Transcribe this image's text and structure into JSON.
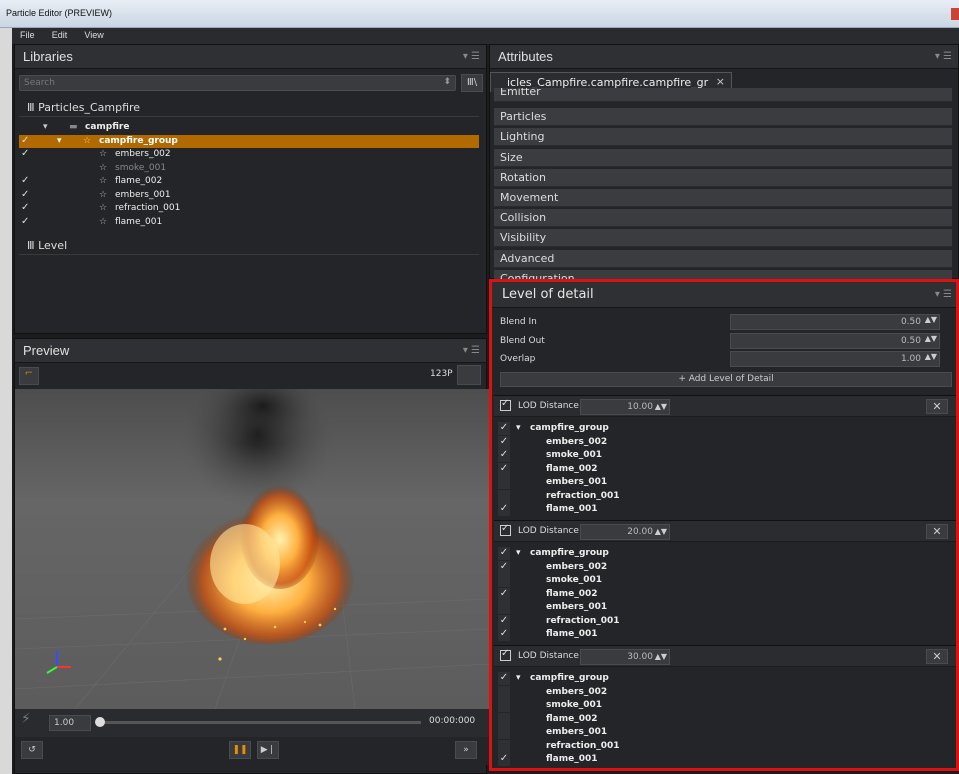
{
  "window": {
    "title": "Particle Editor (PREVIEW)"
  },
  "menu": [
    "File",
    "Edit",
    "View"
  ],
  "libraries": {
    "title": "Libraries",
    "search_placeholder": "Search",
    "library_name": "Particles_Campfire",
    "root_folder": "campfire",
    "group": "campfire_group",
    "items": [
      {
        "name": "embers_002",
        "checked": true
      },
      {
        "name": "smoke_001",
        "checked": false
      },
      {
        "name": "flame_002",
        "checked": true
      },
      {
        "name": "embers_001",
        "checked": true
      },
      {
        "name": "refraction_001",
        "checked": true
      },
      {
        "name": "flame_001",
        "checked": true
      }
    ],
    "level_name": "Level"
  },
  "preview": {
    "title": "Preview",
    "fps_label": "123P",
    "speed": "1.00",
    "time": "00:00:000"
  },
  "attributes": {
    "title": "Attributes",
    "tab_label": "icles_Campfire.campfire.campfire_gr",
    "tab_close": "×",
    "categories": [
      "Emitter",
      "Particles",
      "Lighting",
      "Size",
      "Rotation",
      "Movement",
      "Collision",
      "Visibility",
      "Advanced",
      "Configuration"
    ]
  },
  "lod": {
    "title": "Level of detail",
    "props": [
      {
        "label": "Blend In",
        "value": "0.50"
      },
      {
        "label": "Blend Out",
        "value": "0.50"
      },
      {
        "label": "Overlap",
        "value": "1.00"
      }
    ],
    "add_label": "+ Add Level of Detail",
    "distance_label": "LOD Distance",
    "remove_label": "✕",
    "group": "campfire_group",
    "levels": [
      {
        "distance": "10.00",
        "checks": [
          true,
          true,
          true,
          false,
          false,
          true
        ],
        "group_checked": true
      },
      {
        "distance": "20.00",
        "checks": [
          true,
          false,
          true,
          false,
          true,
          true
        ],
        "group_checked": true
      },
      {
        "distance": "30.00",
        "checks": [
          false,
          false,
          false,
          false,
          false,
          true
        ],
        "group_checked": true
      }
    ],
    "item_names": [
      "embers_002",
      "smoke_001",
      "flame_002",
      "embers_001",
      "refraction_001",
      "flame_001"
    ]
  }
}
